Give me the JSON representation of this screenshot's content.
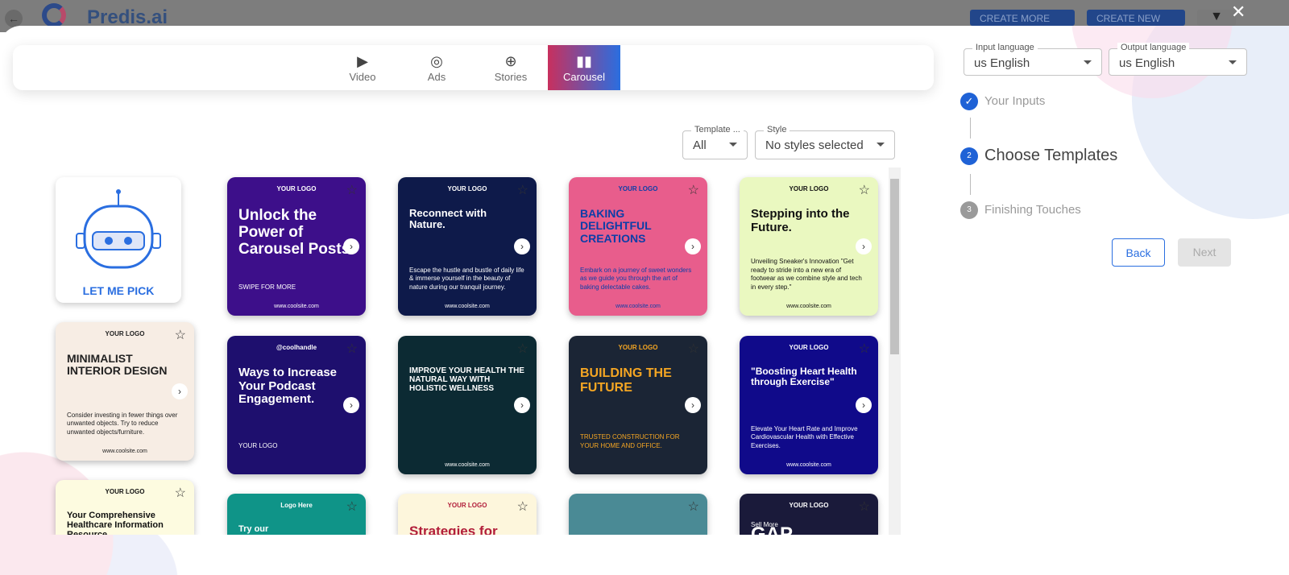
{
  "app": {
    "brand": "Predis.ai",
    "create_more": "CREATE MORE",
    "create_new": "CREATE NEW",
    "close": "✕",
    "back": "←",
    "filter": "▼"
  },
  "tabs": [
    {
      "label": "Video",
      "icon": "▶"
    },
    {
      "label": "Ads",
      "icon": "◎"
    },
    {
      "label": "Stories",
      "icon": "⊕"
    },
    {
      "label": "Carousel",
      "icon": "▮▮"
    }
  ],
  "filters": {
    "template_label": "Template ...",
    "template_value": "All",
    "style_label": "Style",
    "style_value": "No styles selected"
  },
  "language": {
    "input_label": "Input language",
    "input_value": "us English",
    "output_label": "Output language",
    "output_value": "us English"
  },
  "steps": [
    {
      "num": "✓",
      "label": "Your Inputs"
    },
    {
      "num": "2",
      "label": "Choose Templates"
    },
    {
      "num": "3",
      "label": "Finishing Touches"
    }
  ],
  "buttons": {
    "back": "Back",
    "next": "Next"
  },
  "let_me_pick": "LET ME PICK",
  "templates": [
    {
      "bg": "#3d0f8a",
      "fg": "#fff",
      "logo": "YOUR LOGO",
      "title": "Unlock the Power of Carousel Posts.",
      "size": 19,
      "sub": "SWIPE FOR MORE",
      "web": "www.coolsite.com"
    },
    {
      "bg": "#0e1a4a",
      "fg": "#fff",
      "logo": "YOUR LOGO",
      "title": "Reconnect with Nature.",
      "size": 13,
      "sub": "Escape the hustle and bustle of daily life & immerse yourself in the beauty of nature during our tranquil journey.",
      "web": "www.coolsite.com"
    },
    {
      "bg": "#e85d8c",
      "fg": "#0c3ea8",
      "logo": "YOUR LOGO",
      "title": "BAKING DELIGHTFUL CREATIONS",
      "size": 14,
      "sub": "Embark on a journey of sweet wonders as we guide you through the art of baking delectable cakes.",
      "web": "www.coolsite.com"
    },
    {
      "bg": "#eaf8c0",
      "fg": "#111",
      "logo": "YOUR LOGO",
      "title": "Stepping into the Future.",
      "size": 15,
      "sub": "Unveiling Sneaker's Innovation \"Get ready to stride into a new era of footwear as we combine style and tech in every step.\"",
      "web": "www.coolsite.com"
    },
    {
      "bg": "#f7ede4",
      "fg": "#222",
      "logo": "YOUR LOGO",
      "title": "MINIMALIST INTERIOR DESIGN",
      "size": 14,
      "sub": "Consider investing in fewer things over unwanted objects. Try to reduce unwanted objects/furniture.",
      "web": "www.coolsite.com"
    },
    {
      "bg": "#1e0f6e",
      "fg": "#fff",
      "logo": "@coolhandle",
      "title": "Ways to Increase Your Podcast Engagement.",
      "size": 15,
      "sub": "YOUR LOGO",
      "web": ""
    },
    {
      "bg": "#0c2a33",
      "fg": "#fff",
      "logo": "",
      "title": "IMPROVE YOUR HEALTH THE NATURAL WAY WITH HOLISTIC WELLNESS",
      "size": 10,
      "sub": "",
      "web": "www.coolsite.com"
    },
    {
      "bg": "#1b2535",
      "fg": "#f5a623",
      "logo": "YOUR LOGO",
      "title": "BUILDING THE FUTURE",
      "size": 16,
      "sub": "TRUSTED CONSTRUCTION FOR YOUR HOME AND OFFICE.",
      "web": ""
    },
    {
      "bg": "#100a8a",
      "fg": "#fff",
      "logo": "YOUR LOGO",
      "title": "\"Boosting Heart Health through Exercise\"",
      "size": 12,
      "sub": "Elevate Your Heart Rate and Improve Cardiovascular Health with Effective Exercises.",
      "web": "www.coolsite.com"
    },
    {
      "bg": "#fdfbe0",
      "fg": "#111",
      "logo": "YOUR LOGO",
      "title": "Your Comprehensive Healthcare Information Resource.",
      "size": 11,
      "sub": "",
      "web": ""
    },
    {
      "bg": "#0f9488",
      "fg": "#fff",
      "logo": "Logo Here",
      "title": "Try our",
      "size": 11,
      "sub": "",
      "web": ""
    },
    {
      "bg": "#fdf6dc",
      "fg": "#b21e3a",
      "logo": "YOUR LOGO",
      "title": "Strategies for",
      "size": 17,
      "sub": "",
      "web": ""
    },
    {
      "bg": "#4a8a95",
      "fg": "#fff",
      "logo": "",
      "title": "",
      "size": 11,
      "sub": "",
      "web": ""
    },
    {
      "bg": "#1a1a3a",
      "fg": "#fff",
      "logo": "YOUR LOGO",
      "title": "GAP",
      "size": 24,
      "sub": "Sell More",
      "web": ""
    }
  ]
}
